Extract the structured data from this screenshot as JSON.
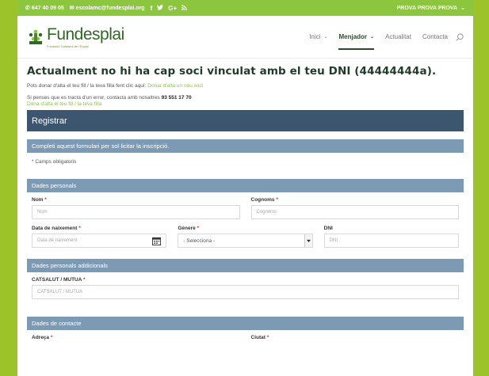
{
  "topbar": {
    "phone": "647 40 09 05",
    "email": "escolamc@fundesplai.org",
    "social": [
      "f",
      "t",
      "G+",
      "rss"
    ],
    "user": "PROVA PROVA PROVA"
  },
  "header": {
    "logo_text": "Fundesplai",
    "logo_sub": "Fundació Catalana de l'Esplai",
    "nav": [
      {
        "label": "Inici",
        "has_dropdown": true,
        "active": false
      },
      {
        "label": "Menjador",
        "has_dropdown": true,
        "active": true
      },
      {
        "label": "Actualitat",
        "has_dropdown": false,
        "active": false
      },
      {
        "label": "Contacta",
        "has_dropdown": false,
        "active": false
      }
    ]
  },
  "main": {
    "title": "Actualment no hi ha cap soci vinculat amb el teu DNI (44444444a).",
    "line1_text": "Pots donar d'alta el teu fill / la teva filla fent clic aquí:",
    "line1_link": "Donar d'alta un nou soci",
    "line2_text": "Si penses que es tracta d'un error, contacta amb nosaltres",
    "line2_phone": "93 551 17 70",
    "line3_link": "Dóna d'alta el teu fill / la teva filla"
  },
  "form": {
    "heading": "Registrar",
    "intro_section": "Completi aquest formulari per sol·licitar la inscripció.",
    "required_note": "* Camps obligatoris",
    "personal": {
      "section": "Dades personals",
      "nom_label": "Nom",
      "nom_placeholder": "Nom",
      "cognoms_label": "Cognoms",
      "cognoms_placeholder": "Cognoms",
      "naixement_label": "Data de naixement",
      "naixement_placeholder": "Data de naixement",
      "genere_label": "Gènere",
      "genere_value": "- Selecciona -",
      "dni_label": "DNI",
      "dni_placeholder": "DNI"
    },
    "additional": {
      "section": "Dades personals addicionals",
      "catsalut_label": "CATSALUT / MUTUA",
      "catsalut_placeholder": "CATSALUT / MUTUA"
    },
    "contact": {
      "section": "Dades de contacte",
      "adreca_label": "Adreça",
      "ciutat_label": "Ciutat"
    },
    "required_mark": "*"
  },
  "colors": {
    "brand_green": "#8cc63f",
    "header_dark": "#3d5670",
    "section_blue": "#7d9ab5",
    "title_dark": "#1f3b2a"
  }
}
